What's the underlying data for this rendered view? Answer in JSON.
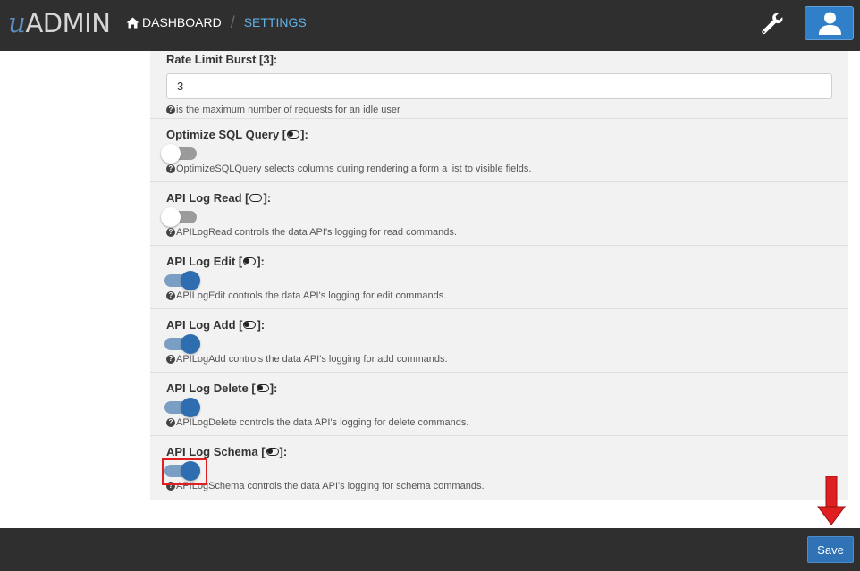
{
  "brand": {
    "logo_u": "u",
    "logo_rest": "ADMIN"
  },
  "nav": {
    "home_icon": "home-icon",
    "dashboard_label": "DASHBOARD",
    "separator": "/",
    "settings_label": "SETTINGS",
    "wrench_icon": "wrench-icon",
    "user_icon": "user-icon"
  },
  "form": {
    "rate_limit_burst": {
      "label": "Rate Limit Burst [3]:",
      "value": "3",
      "hint": "is the maximum number of requests for an idle user"
    },
    "optimize_sql": {
      "label_prefix": "Optimize SQL Query [",
      "label_suffix": "]:",
      "checked": false,
      "hint": "OptimizeSQLQuery selects columns during rendering a form a list to visible fields."
    },
    "api_log_read": {
      "label_prefix": "API Log Read [",
      "label_suffix": "]:",
      "checked": false,
      "hint": "APILogRead controls the data API's logging for read commands."
    },
    "api_log_edit": {
      "label_prefix": "API Log Edit [",
      "label_suffix": "]:",
      "checked": true,
      "hint": "APILogEdit controls the data API's logging for edit commands."
    },
    "api_log_add": {
      "label_prefix": "API Log Add [",
      "label_suffix": "]:",
      "checked": true,
      "hint": "APILogAdd controls the data API's logging for add commands."
    },
    "api_log_delete": {
      "label_prefix": "API Log Delete [",
      "label_suffix": "]:",
      "checked": true,
      "hint": "APILogDelete controls the data API's logging for delete commands."
    },
    "api_log_schema": {
      "label_prefix": "API Log Schema [",
      "label_suffix": "]:",
      "checked": true,
      "hint": "APILogSchema controls the data API's logging for schema commands."
    }
  },
  "footer": {
    "save_label": "Save"
  },
  "colors": {
    "topbar": "#2f2f2f",
    "accent": "#2f72b5",
    "highlight": "#e02020",
    "arrow": "#e02020"
  }
}
